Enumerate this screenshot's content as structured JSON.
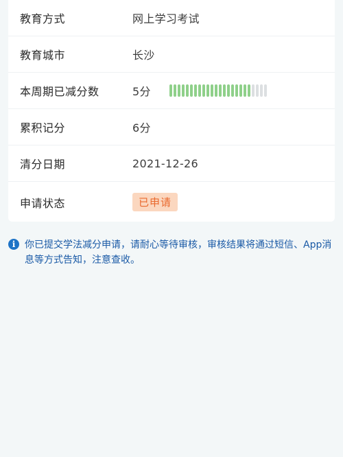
{
  "details": {
    "rows": [
      {
        "label": "教育方式",
        "value": "网上学习考试"
      },
      {
        "label": "教育城市",
        "value": "长沙"
      },
      {
        "label": "本周期已减分数",
        "value": "5分"
      },
      {
        "label": "累积记分",
        "value": "6分"
      },
      {
        "label": "清分日期",
        "value": "2021-12-26"
      },
      {
        "label": "申请状态",
        "value": "已申请"
      }
    ]
  },
  "reduction_progress": {
    "filled_segments": 20,
    "total_segments": 24,
    "fill_color": "#8fd08a",
    "empty_color": "#dcdfe1"
  },
  "status_badge": {
    "bg_color": "#fbd7bf",
    "text_color": "#e9692e"
  },
  "notice": {
    "icon": "info-icon",
    "text": "你已提交学法减分申请，请耐心等待审核，审核结果将通过短信、App消息等方式告知，注意查收。",
    "color": "#1a5aa6"
  }
}
